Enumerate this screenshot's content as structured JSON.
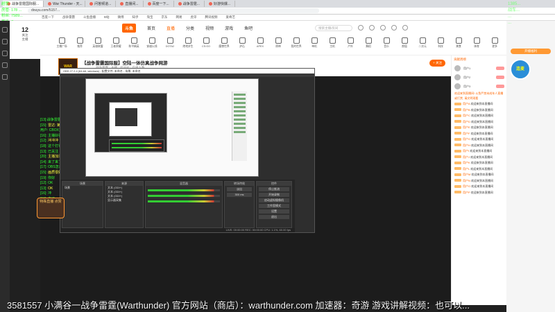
{
  "browser": {
    "tabs": [
      "战争雷霆国际服...",
      "War Thunder - 天...",
      "问答频道...",
      "直播间...",
      "百度一下...",
      "战争雷霆...",
      "好游快爆..."
    ],
    "address": "douyu.com/5157...",
    "bookmarks": [
      "百度一下",
      "战争雷霆",
      "斗鱼直播",
      "B站",
      "微博",
      "知乎",
      "淘宝",
      "京东",
      "网易",
      "虎牙",
      "腾讯视频",
      "爱奇艺"
    ]
  },
  "overlay_top_left": [
    "超管:",
    "房管: 178 ...",
    "粉丝: 7589...",
    "等级: 7"
  ],
  "overlay_top_right": [
    "1385...",
    "战车...",
    "...",
    "..."
  ],
  "side": {
    "num": "12",
    "label": "关注",
    "sub": "主播"
  },
  "site": {
    "logo": "斗鱼",
    "nav": [
      "首页",
      "直播",
      "分类",
      "视频",
      "游戏",
      "鱼吧"
    ],
    "active": "直播",
    "search_placeholder": "搜索主播/房间"
  },
  "categories": [
    "主播广场",
    "推荐",
    "英雄联盟",
    "王者荣耀",
    "和平精英",
    "穿越火线",
    "DOTA2",
    "绝地求生",
    "CS:GO",
    "魔兽世界",
    "炉石",
    "APEX",
    "原神",
    "我的世界",
    "单机",
    "主机",
    "户外",
    "舞蹈",
    "音乐",
    "颜值",
    "二次元",
    "科技",
    "美食",
    "体育",
    "更多"
  ],
  "room": {
    "thumb": "WAR THUNDER",
    "title": "【战争雷霆国际服】空陆一体仿真战争网游",
    "meta": "战争雷霆 · 主播 · 房间号 · 在线人数",
    "follow": "+ 关注"
  },
  "danmu_left": [
    {
      "u": "[13]:",
      "t": "战争雷霆",
      "c": "#3f3"
    },
    {
      "u": "[15]: ",
      "t": "雷达: 第一个",
      "c": "#ff4"
    },
    {
      "u": "用户: ",
      "t": "CBOX直播 C",
      "c": "#3f3"
    },
    {
      "u": "[16]: ",
      "t": "主播好强",
      "c": "#3f3"
    },
    {
      "u": "[12]: ",
      "t": "冲冲冲",
      "c": "#ff4"
    },
    {
      "u": "[18]: ",
      "t": "这个打得好",
      "c": "#3f3"
    },
    {
      "u": "[13]: ",
      "t": "已关注",
      "c": "#3f3"
    },
    {
      "u": "[20]: ",
      "t": "主播加油 666",
      "c": "#ff4"
    },
    {
      "u": "[14]: ",
      "t": "来了来了",
      "c": "#3f3"
    },
    {
      "u": "[17]: ",
      "t": "OBS怎么设置",
      "c": "#3f3"
    },
    {
      "u": "[15]: ",
      "t": "画质很好",
      "c": "#ff4"
    },
    {
      "u": "[19]: ",
      "t": "你好",
      "c": "#3f3"
    },
    {
      "u": "[12]: ",
      "t": "OK",
      "c": "#3f3"
    },
    {
      "u": "[13]: ",
      "t": "OK",
      "c": "#ff4"
    },
    {
      "u": "[16]: ",
      "t": "冲",
      "c": "#3f3"
    },
    {
      "u": "[18]: ",
      "t": "来了",
      "c": "#3f3"
    }
  ],
  "obs": {
    "title": "OBS 27.2.4 (64-bit, windows) - 配置文件: 未命名 - 场景: 未命名",
    "panels": {
      "scenes": "场景",
      "sources": "来源",
      "mixer": "混音器",
      "transitions": "转场特效",
      "controls": "控件"
    },
    "scene_item": "场景",
    "sources_items": [
      "文本 (GDI+)",
      "文本 (GDI+)",
      "文本 (GDI+)",
      "显示器采集"
    ],
    "controls_buttons": [
      "停止推流",
      "开始录制",
      "启动虚拟摄像机",
      "工作室模式",
      "设置",
      "退出"
    ],
    "transition_value": "淡出",
    "duration": "300 ms",
    "status": "LIVE: 00:00:00  REC: 00:00:00  CPU: 1.1%, 60.00 fps"
  },
  "sticker": "特殊直播\n点赞",
  "chat": {
    "header": "贡献周榜",
    "ranks": [
      "用户1",
      "用户2",
      "用户3"
    ],
    "notice": "欢迎来到直播间! 斗鱼严禁未成年人直播或打赏, 请文明观看",
    "messages": [
      {
        "u": "用户A",
        "t": "欢迎来到本直播间"
      },
      {
        "u": "用户B",
        "t": "欢迎来到本直播间"
      },
      {
        "u": "用户C",
        "t": "欢迎来到本直播间"
      },
      {
        "u": "用户D",
        "t": "欢迎来到本直播间"
      },
      {
        "u": "用户E",
        "t": "欢迎来到本直播间"
      },
      {
        "u": "用户F",
        "t": "欢迎来到本直播间"
      },
      {
        "u": "用户G",
        "t": "欢迎来到本直播间"
      },
      {
        "u": "用户H",
        "t": "欢迎来到本直播间"
      },
      {
        "u": "用户I",
        "t": "欢迎来到本直播间"
      },
      {
        "u": "用户J",
        "t": "欢迎来到本直播间"
      },
      {
        "u": "用户K",
        "t": "欢迎来到本直播间"
      },
      {
        "u": "用户L",
        "t": "欢迎来到本直播间"
      },
      {
        "u": "用户M",
        "t": "欢迎来到本直播间"
      },
      {
        "u": "用户N",
        "t": "欢迎来到本直播间"
      },
      {
        "u": "用户O",
        "t": "欢迎来到本直播间"
      },
      {
        "u": "用户P",
        "t": "欢迎来到本直播间"
      }
    ]
  },
  "gift_badge": "连麦",
  "promo": "开播福利",
  "ticker": "3581557 小满谷一战争雷霆(Warthunder) 官方网站（商店）：warthunder.com 加速器：奇游 游戏讲解视频：也可以..."
}
